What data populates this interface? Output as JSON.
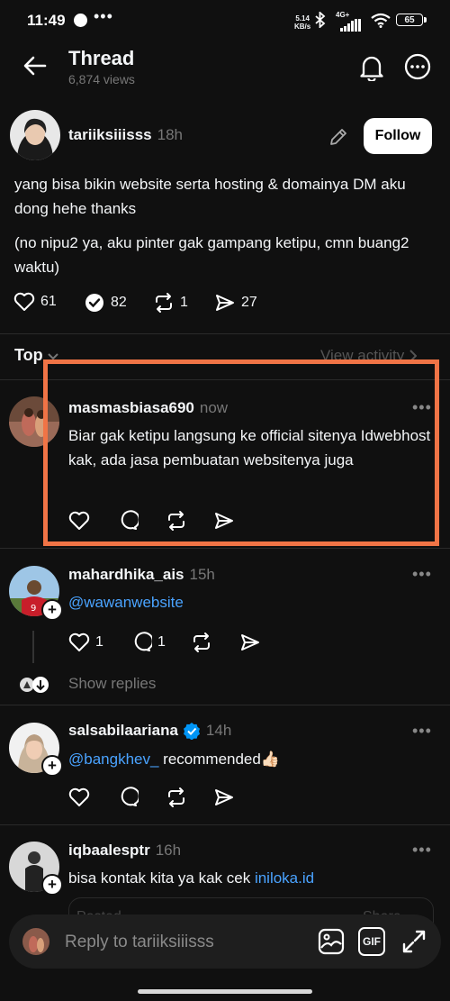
{
  "status_bar": {
    "time": "11:49",
    "speed_value": "5.14",
    "speed_unit": "KB/s",
    "network": "4G+",
    "battery": "65"
  },
  "header": {
    "title": "Thread",
    "views": "6,874 views"
  },
  "post": {
    "username": "tariiksiiisss",
    "time": "18h",
    "follow_label": "Follow",
    "text_1": "yang bisa bikin website serta hosting & domainya DM aku dong hehe thanks",
    "text_2": "(no nipu2 ya, aku pinter gak gampang ketipu, cmn buang2 waktu)",
    "likes": "61",
    "replies": "82",
    "reposts": "1",
    "shares": "27"
  },
  "sort": {
    "label": "Top",
    "view_activity": "View activity"
  },
  "replies": [
    {
      "username": "masmasbiasa690",
      "time": "now",
      "text": "Biar gak ketipu langsung ke official sitenya Idwebhost kak, ada jasa pembuatan websitenya juga"
    },
    {
      "username": "mahardhika_ais",
      "time": "15h",
      "mention": "@wawanwebsite",
      "likes": "1",
      "replies": "1",
      "show_replies": "Show replies"
    },
    {
      "username": "salsabilaariana",
      "time": "14h",
      "mention": "@bangkhev_",
      "text": " recommended👍🏻"
    },
    {
      "username": "iqbaalesptr",
      "time": "16h",
      "text": "bisa kontak kita ya kak cek ",
      "link": "iniloka.id",
      "ghost_posted": "Posted",
      "ghost_share": "Share"
    }
  ],
  "reply_bar": {
    "placeholder": "Reply to tariiksiiisss",
    "gif_label": "GIF"
  },
  "colors": {
    "background": "#101010",
    "highlight": "#f07446",
    "link": "#4aa3ff",
    "verified": "#0095f6"
  }
}
